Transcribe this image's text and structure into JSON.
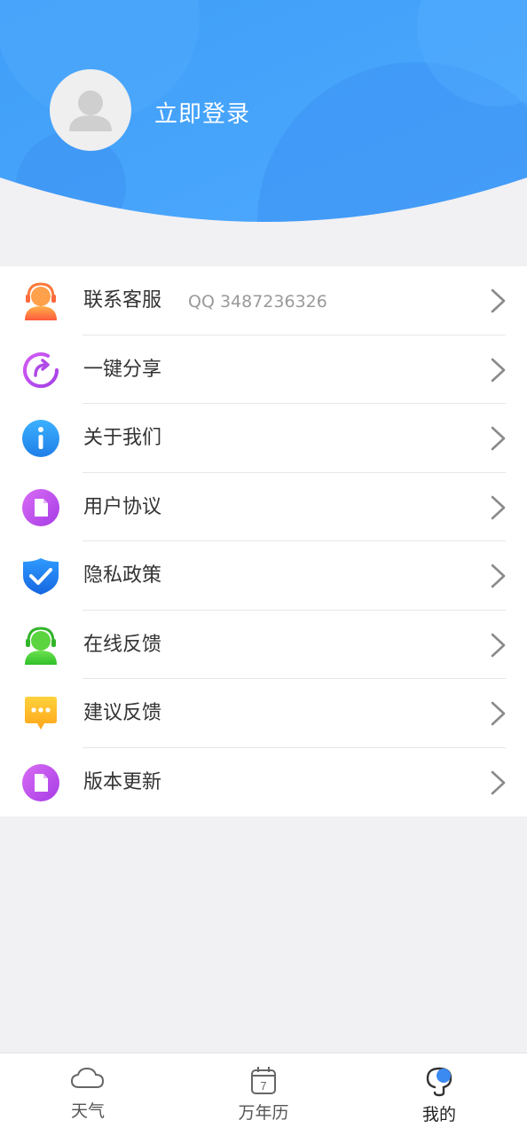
{
  "header": {
    "login_label": "立即登录"
  },
  "menu": {
    "items": [
      {
        "label": "联系客服",
        "extra": "QQ 3487236326",
        "icon": "customer-service-icon"
      },
      {
        "label": "一键分享",
        "extra": "",
        "icon": "share-icon"
      },
      {
        "label": "关于我们",
        "extra": "",
        "icon": "info-icon"
      },
      {
        "label": "用户协议",
        "extra": "",
        "icon": "document-icon"
      },
      {
        "label": "隐私政策",
        "extra": "",
        "icon": "shield-check-icon"
      },
      {
        "label": "在线反馈",
        "extra": "",
        "icon": "online-feedback-icon"
      },
      {
        "label": "建议反馈",
        "extra": "",
        "icon": "chat-bubble-icon"
      },
      {
        "label": "版本更新",
        "extra": "",
        "icon": "document-icon"
      }
    ]
  },
  "bottom_nav": {
    "items": [
      {
        "label": "天气",
        "icon": "cloud-icon"
      },
      {
        "label": "万年历",
        "icon": "calendar-icon"
      },
      {
        "label": "我的",
        "icon": "profile-icon"
      }
    ],
    "active_index": 2,
    "calendar_day": "7"
  },
  "colors": {
    "header_blue": "#4aa7fb",
    "page_bg": "#f1f0f3"
  }
}
